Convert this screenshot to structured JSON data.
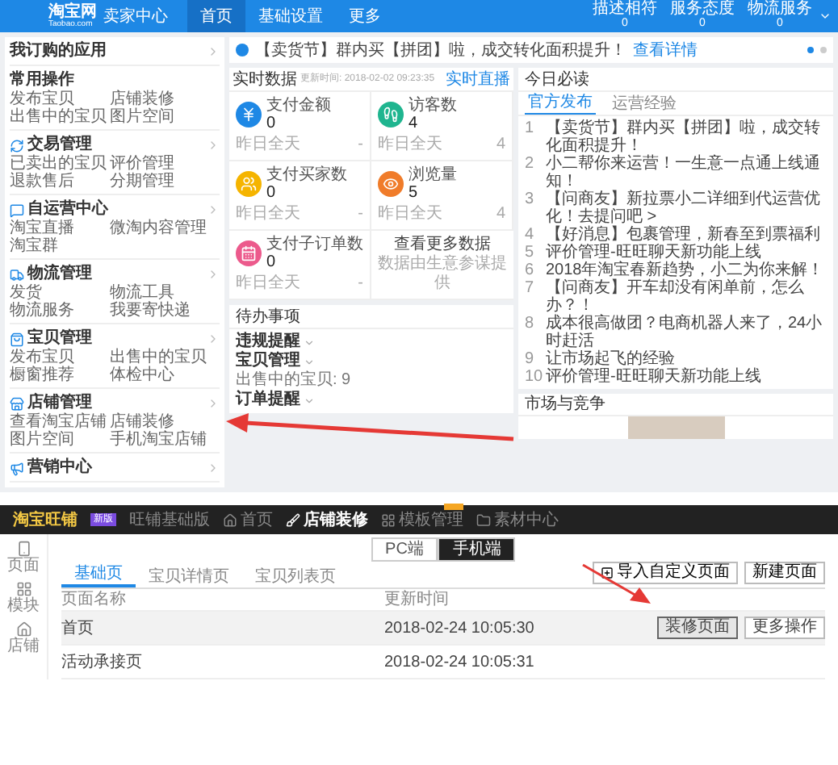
{
  "top_window": {
    "header": {
      "logo": "淘宝网",
      "logo_sub": "Taobao.com",
      "title": "卖家中心",
      "nav": [
        {
          "label": "首页",
          "selected": true
        },
        {
          "label": "基础设置",
          "selected": false
        },
        {
          "label": "更多",
          "selected": false
        }
      ],
      "ratings": [
        {
          "label": "描述相符",
          "value": "0"
        },
        {
          "label": "服务态度",
          "value": "0"
        },
        {
          "label": "物流服务",
          "value": "0"
        }
      ]
    },
    "sidebar": {
      "subscribed": "我订购的应用",
      "groups": [
        {
          "title": "常用操作",
          "links": [
            "发布宝贝",
            "店铺装修",
            "出售中的宝贝",
            "图片空间"
          ]
        },
        {
          "title": "交易管理",
          "links": [
            "已卖出的宝贝",
            "评价管理",
            "退款售后",
            "分期管理"
          ]
        },
        {
          "title": "自运营中心",
          "links": [
            "淘宝直播",
            "微淘内容管理",
            "淘宝群"
          ]
        },
        {
          "title": "物流管理",
          "links": [
            "发货",
            "物流工具",
            "物流服务",
            "我要寄快递"
          ]
        },
        {
          "title": "宝贝管理",
          "links": [
            "发布宝贝",
            "出售中的宝贝",
            "橱窗推荐",
            "体检中心"
          ]
        },
        {
          "title": "店铺管理",
          "links": [
            "查看淘宝店铺",
            "店铺装修",
            "图片空间",
            "手机淘宝店铺"
          ]
        },
        {
          "title": "营销中心"
        }
      ]
    },
    "notice": {
      "text": "【卖货节】群内买【拼团】啦，成交转化面积提升！",
      "link": "查看详情"
    },
    "realtime": {
      "title": "实时数据",
      "updated": "更新时间: 2018-02-02 09:23:35",
      "link": "实时直播",
      "metrics": [
        {
          "label": "支付金额",
          "value": "0",
          "compare_label": "昨日全天",
          "compare_value": "-",
          "color": "#1e88e5"
        },
        {
          "label": "访客数",
          "value": "4",
          "compare_label": "昨日全天",
          "compare_value": "4",
          "color": "#1fb58f"
        },
        {
          "label": "支付买家数",
          "value": "0",
          "compare_label": "昨日全天",
          "compare_value": "-",
          "color": "#f5b400"
        },
        {
          "label": "浏览量",
          "value": "5",
          "compare_label": "昨日全天",
          "compare_value": "4",
          "color": "#f07c2a"
        },
        {
          "label": "支付子订单数",
          "value": "0",
          "compare_label": "昨日全天",
          "compare_value": "-",
          "color": "#ec5a8c"
        }
      ],
      "more": {
        "title": "查看更多数据",
        "note": "数据由生意参谋提供"
      }
    },
    "todo": {
      "title": "待办事项",
      "items": [
        {
          "kind": "heading",
          "text": "违规提醒"
        },
        {
          "kind": "heading",
          "text": "宝贝管理"
        },
        {
          "kind": "detail",
          "text": "出售中的宝贝: 9"
        },
        {
          "kind": "heading",
          "text": "订单提醒"
        }
      ]
    },
    "reading": {
      "title": "今日必读",
      "tabs": [
        {
          "label": "官方发布",
          "selected": true
        },
        {
          "label": "运营经验",
          "selected": false
        }
      ],
      "items": [
        {
          "index": "1",
          "text": "【卖货节】群内买【拼团】啦，成交转化面积提升！"
        },
        {
          "index": "2",
          "text": "小二帮你来运营！一生意一点通上线通知！"
        },
        {
          "index": "3",
          "text": "【问商友】新拉票小二详细到代运营优化！去提问吧 >"
        },
        {
          "index": "4",
          "text": "【好消息】包裹管理，新春至到票福利"
        },
        {
          "index": "5",
          "text": "评价管理-旺旺聊天新功能上线"
        },
        {
          "index": "6",
          "text": "2018年淘宝春新趋势，小二为你来解！"
        },
        {
          "index": "7",
          "text": "【问商友】开车却没有闲单前，怎么办？！"
        },
        {
          "index": "8",
          "text": "成本很高做团？电商机器人来了，24小时赶活"
        },
        {
          "index": "9",
          "text": "让市场起飞的经验"
        },
        {
          "index": "10",
          "text": "评价管理-旺旺聊天新功能上线"
        }
      ]
    },
    "market": {
      "title": "市场与竞争"
    }
  },
  "bottom_window": {
    "header": {
      "logo": "淘宝旺铺",
      "badge": "新版",
      "nav": [
        {
          "label": "旺铺基础版",
          "selected": false,
          "flagged": false
        },
        {
          "label": "首页",
          "selected": false,
          "flagged": false
        },
        {
          "label": "店铺装修",
          "selected": true,
          "flagged": false
        },
        {
          "label": "模板管理",
          "selected": false,
          "flagged": true
        },
        {
          "label": "素材中心",
          "selected": false,
          "flagged": false
        }
      ]
    },
    "rail": [
      {
        "label": "页面"
      },
      {
        "label": "模块"
      },
      {
        "label": "店铺"
      }
    ],
    "device_toggle": [
      {
        "label": "PC端",
        "selected": false
      },
      {
        "label": "手机端",
        "selected": true
      }
    ],
    "tabs": [
      {
        "label": "基础页",
        "selected": true
      },
      {
        "label": "宝贝详情页",
        "selected": false
      },
      {
        "label": "宝贝列表页",
        "selected": false
      }
    ],
    "actions": [
      "导入自定义页面",
      "新建页面"
    ],
    "table": {
      "columns": [
        "页面名称",
        "更新时间"
      ],
      "rows": [
        {
          "name": "首页",
          "updated": "2018-02-24 10:05:30",
          "selected": true,
          "buttons": [
            "装修页面",
            "更多操作"
          ]
        },
        {
          "name": "活动承接页",
          "updated": "2018-02-24 10:05:31",
          "selected": false,
          "buttons": []
        }
      ]
    }
  }
}
